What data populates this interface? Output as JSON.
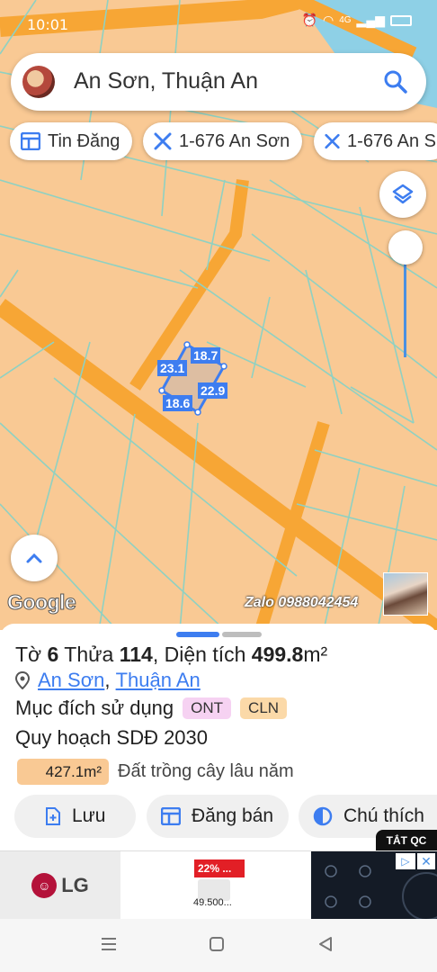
{
  "status": {
    "time": "10:01",
    "network": "4G"
  },
  "search": {
    "title": "An Sơn, Thuận An"
  },
  "chips": [
    {
      "label": "Tin Đăng"
    },
    {
      "label": "1-676 An Sơn"
    },
    {
      "label": "1-676 An S"
    }
  ],
  "parcel": {
    "edges": [
      "18.7",
      "23.1",
      "22.9",
      "18.6"
    ]
  },
  "map": {
    "logo": "Google",
    "watermark": "Zalo 0988042454"
  },
  "info": {
    "sheet_prefix": "Tờ ",
    "sheet_no": "6",
    "plot_prefix": " Thửa ",
    "plot_no": "114",
    "area_prefix": ", Diện tích ",
    "area_value": "499.8",
    "area_unit": "m²",
    "ward": "An Sơn",
    "district": "Thuận An",
    "purpose_label": "Mục đích sử dụng",
    "purpose_codes": [
      "ONT",
      "CLN"
    ],
    "planning_label": "Quy hoạch SDĐ 2030",
    "planning_area": "427.1m²",
    "planning_desc": "Đất trồng cây lâu năm"
  },
  "actions": {
    "save": "Lưu",
    "post": "Đăng bán",
    "legend": "Chú thích"
  },
  "ad": {
    "tag": "TẮT QC",
    "brand": "LG",
    "discount": "22% ...",
    "price": "49.500..."
  },
  "colors": {
    "accent": "#3d7df0",
    "map_land": "#f9c994",
    "road": "#f7a635",
    "ont_badge": "#f6d2f2",
    "cln_badge": "#fbd9a8"
  }
}
